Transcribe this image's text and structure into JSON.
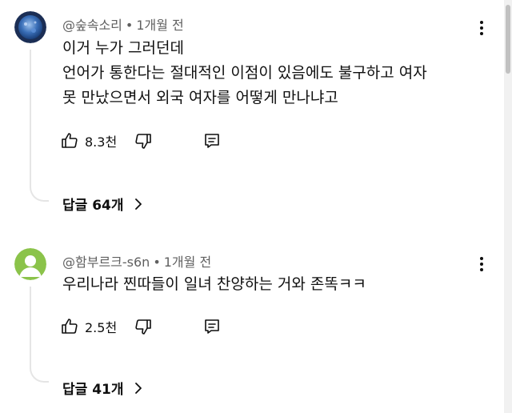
{
  "comments": [
    {
      "author": "@숲속소리",
      "time": "1개월 전",
      "text_lines": [
        "이거 누가 그러던데",
        "언어가 통한다는 절대적인 이점이 있음에도 불구하고 여자",
        "못 만났으면서 외국 여자를 어떻게 만나냐고"
      ],
      "likes": "8.3천",
      "replies": "답글 64개"
    },
    {
      "author": "@함부르크-s6n",
      "time": "1개월 전",
      "text_lines": [
        "우리나라 찐따들이 일녀 찬양하는 거와 존똑ㅋㅋ"
      ],
      "likes": "2.5천",
      "replies": "답글 41개"
    }
  ],
  "separator": "•",
  "icons": {
    "like": "thumbs-up-icon",
    "dislike": "thumbs-down-icon",
    "reply": "reply-icon",
    "more": "more-vertical-icon",
    "expand": "chevron-right-icon"
  },
  "colors": {
    "avatar1_bg": "#2c5aa0",
    "avatar2_bg": "#8bc34a",
    "meta_text": "#606060"
  }
}
